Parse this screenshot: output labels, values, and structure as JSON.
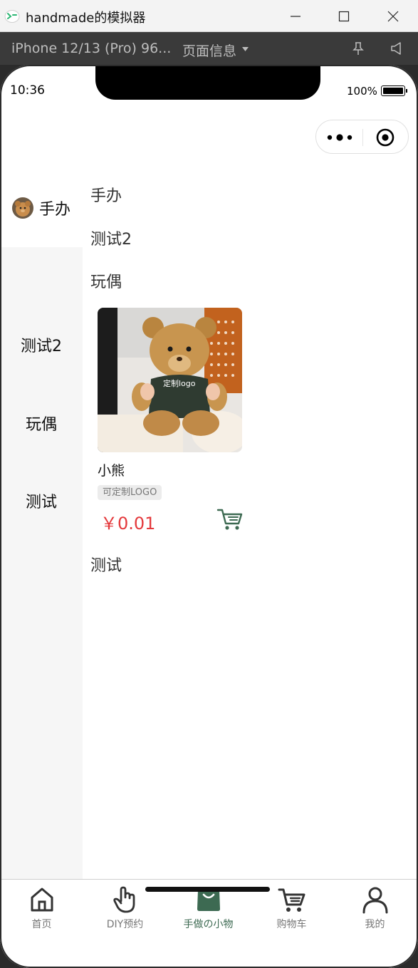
{
  "window": {
    "title": "handmade的模拟器",
    "icon": "wechat-devtools-icon"
  },
  "simulator": {
    "device": "iPhone 12/13 (Pro) 96...",
    "page_info": "页面信息"
  },
  "status_bar": {
    "time": "10:36",
    "battery": "100%"
  },
  "sidebar": {
    "items": [
      {
        "label": "手办",
        "active": true,
        "icon": "bear-avatar"
      },
      {
        "label": "测试2",
        "active": false
      },
      {
        "label": "玩偶",
        "active": false
      },
      {
        "label": "测试",
        "active": false
      }
    ]
  },
  "sections": [
    {
      "title": "手办"
    },
    {
      "title": "测试2"
    },
    {
      "title": "玩偶"
    },
    {
      "title": "测试"
    }
  ],
  "product": {
    "name": "小熊",
    "tag": "可定制LOGO",
    "price": "￥0.01",
    "shirt_text": "定制logo"
  },
  "tabbar": {
    "items": [
      {
        "label": "首页",
        "icon": "home-icon"
      },
      {
        "label": "DIY预约",
        "icon": "hand-icon"
      },
      {
        "label": "手做の小物",
        "icon": "bag-icon",
        "active": true
      },
      {
        "label": "购物车",
        "icon": "cart-icon"
      },
      {
        "label": "我的",
        "icon": "user-icon"
      }
    ]
  },
  "colors": {
    "accent": "#3d6a52",
    "price": "#e4393c",
    "sidebar_bg": "#f6f6f6"
  }
}
